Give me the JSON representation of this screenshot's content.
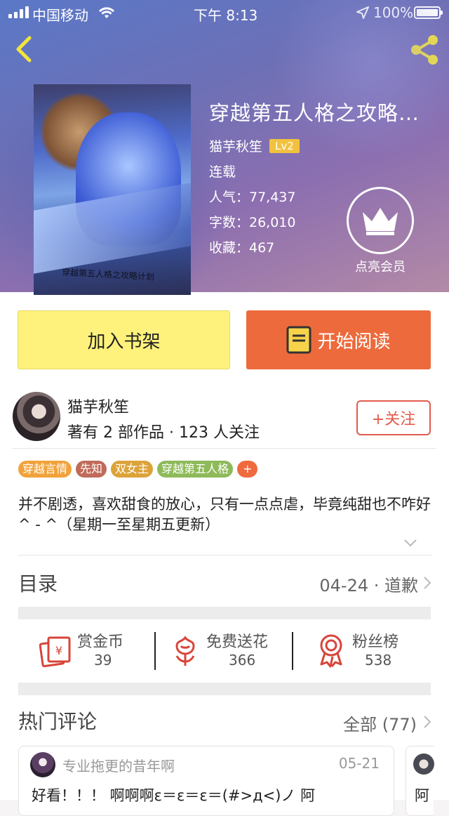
{
  "status_bar": {
    "carrier": "中国移动",
    "time": "下午 8:13",
    "battery": "100%"
  },
  "book": {
    "title": "穿越第五人格之攻略…",
    "cover_text": "穿越第五人格之攻略计划",
    "author": "猫芋秋笙",
    "level": "Lv2",
    "status": "连载",
    "popularity": "人气：77,437",
    "word_count": "字数：26,010",
    "favorites": "收藏：467"
  },
  "vip": {
    "label": "点亮会员"
  },
  "actions": {
    "add_shelf": "加入书架",
    "start_read": "开始阅读"
  },
  "author_info": {
    "name": "猫芋秋笙",
    "meta": "著有 2 部作品 · 123 人关注",
    "follow_label": "+关注"
  },
  "tags": [
    {
      "label": "穿越言情",
      "color": "#f2a23a"
    },
    {
      "label": "先知",
      "color": "#c06b5a"
    },
    {
      "label": "双女主",
      "color": "#dca33a"
    },
    {
      "label": "穿越第五人格",
      "color": "#8eba5a"
    },
    {
      "label": "+",
      "color": "#ef6a3e"
    }
  ],
  "description": "并不剧透，喜欢甜食的放心，只有一点点虐，毕竟纯甜也不咋好^ - ^（星期一至星期五更新）",
  "toc": {
    "title": "目录",
    "latest": "04-24 · 道歉"
  },
  "stats": [
    {
      "label": "赏金币",
      "value": "39",
      "icon": "coin-envelope-icon"
    },
    {
      "label": "免费送花",
      "value": "366",
      "icon": "flower-icon"
    },
    {
      "label": "粉丝榜",
      "value": "538",
      "icon": "ribbon-badge-icon"
    }
  ],
  "comments": {
    "title": "热门评论",
    "all_label": "全部 (77)",
    "items": [
      {
        "user": "专业拖更的昔年啊",
        "date": "05-21",
        "text": "好看！！！ 啊啊啊ε＝ε＝ε＝(#>д<)ノ 阿"
      }
    ],
    "next_preview": "阿"
  },
  "colors": {
    "accent": "#ec6a3c",
    "shelf": "#fff27c",
    "follow": "#e25b4b",
    "level": "#f2c23f",
    "stat_icon": "#d8453a"
  }
}
